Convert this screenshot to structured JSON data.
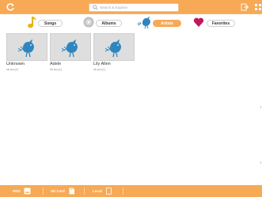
{
  "colors": {
    "accent": "#f7a956",
    "card_bg": "#dedede",
    "heart": "#c2185b",
    "bird": "#2f86bf"
  },
  "search": {
    "placeholder": "Search & Explore"
  },
  "tabs": [
    {
      "label": "Songs",
      "icon": "music-note-icon",
      "active": false
    },
    {
      "label": "Albums",
      "icon": "disc-icon",
      "active": false
    },
    {
      "label": "Artists",
      "icon": "artist-icon",
      "active": true
    },
    {
      "label": "Favorites",
      "icon": "heart-icon",
      "active": false
    }
  ],
  "artists": [
    {
      "name": "Unknown",
      "count": "Music(2)"
    },
    {
      "name": "Adele",
      "count": "Music(1)"
    },
    {
      "name": "Lily Allen",
      "count": "Music(1)"
    }
  ],
  "storage": [
    {
      "label": "HDD",
      "icon": "hdd-icon"
    },
    {
      "label": "SD Card",
      "icon": "sd-card-icon"
    },
    {
      "label": "Local",
      "icon": "tablet-icon"
    }
  ]
}
